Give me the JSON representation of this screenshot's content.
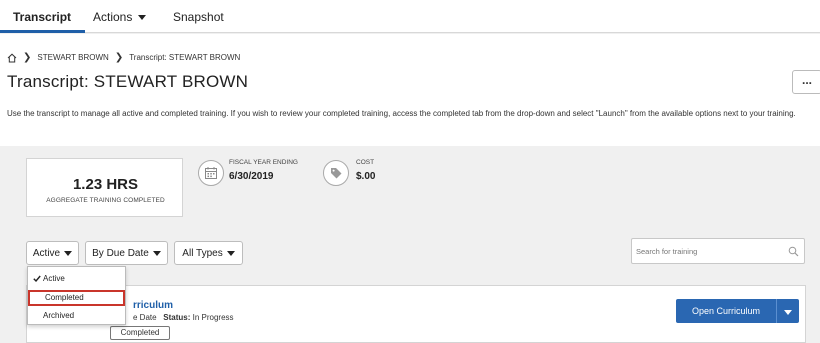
{
  "nav": {
    "tabs": [
      {
        "label": "Transcript",
        "active": true
      },
      {
        "label": "Actions",
        "has_caret": true
      },
      {
        "label": "Snapshot"
      }
    ]
  },
  "breadcrumb": {
    "items": [
      "STEWART BROWN",
      "Transcript: STEWART BROWN"
    ]
  },
  "page": {
    "title": "Transcript: STEWART BROWN",
    "more_label": "...",
    "description": "Use the transcript to manage all active and completed training. If you wish to review your completed training, access the completed tab from the drop-down and select \"Launch\" from the available options next to your training."
  },
  "stats": {
    "aggregate": {
      "value": "1.23 HRS",
      "label": "AGGREGATE TRAINING COMPLETED"
    },
    "fiscal": {
      "label": "FISCAL YEAR ENDING",
      "value": "6/30/2019",
      "icon": "calendar-icon"
    },
    "cost": {
      "label": "COST",
      "value": "$.00",
      "icon": "tag-icon"
    }
  },
  "filters": {
    "status": "Active",
    "sort": "By Due Date",
    "types": "All Types",
    "search_placeholder": "Search for training"
  },
  "dropdown": {
    "items": [
      {
        "label": "Active",
        "checked": true
      },
      {
        "label": "Completed",
        "highlighted": true
      },
      {
        "label": "Archived"
      }
    ]
  },
  "result": {
    "title_fragment": "rriculum",
    "meta_fragment": "e Date",
    "status_label": "Status:",
    "status_value": "In Progress",
    "tooltip": "Completed",
    "open_button": "Open Curriculum"
  },
  "colors": {
    "accent": "#1f5fa8",
    "button": "#2a67b2",
    "highlight": "#c9352b"
  }
}
